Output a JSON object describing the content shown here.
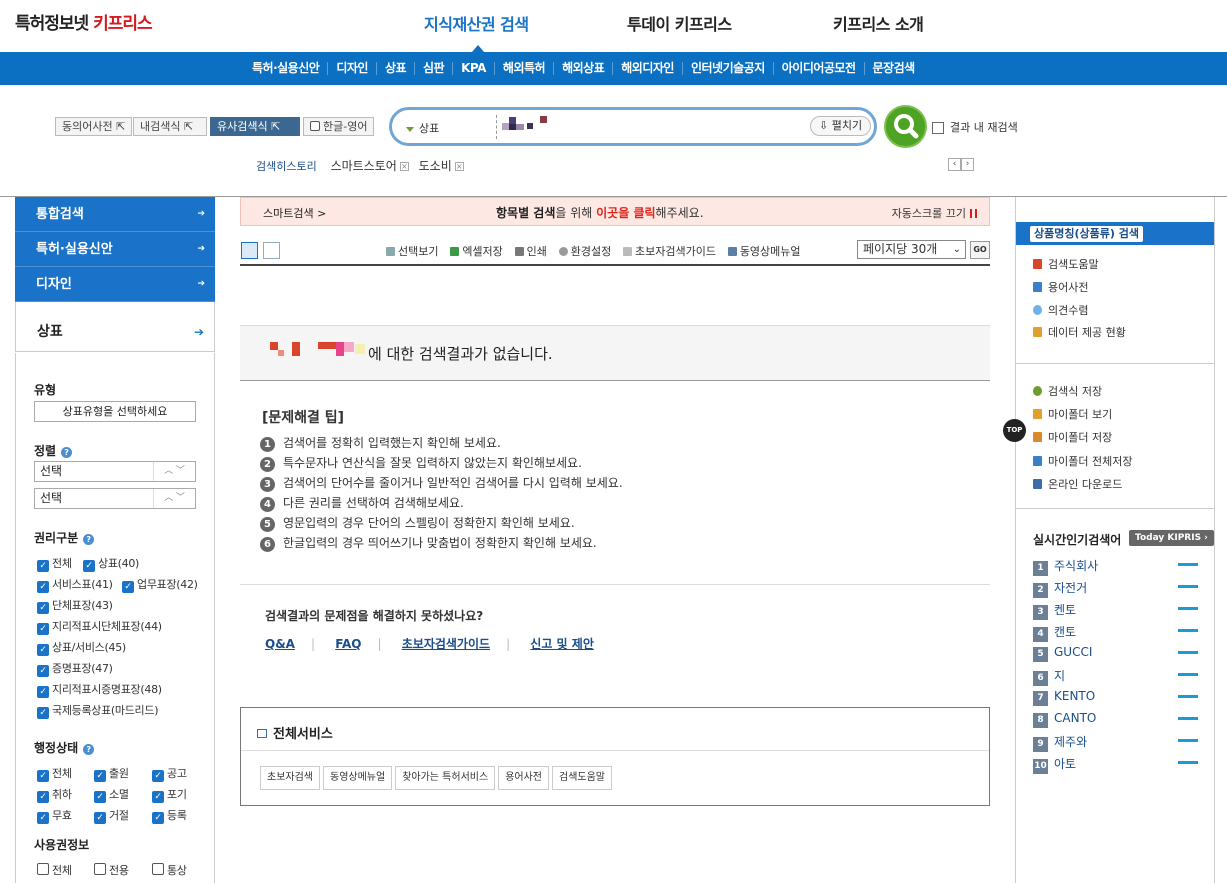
{
  "header": {
    "logo_main": "특허정보넷",
    "logo_brand": "키프리스",
    "nav": [
      "지식재산권 검색",
      "투데이 키프리스",
      "키프리스 소개"
    ]
  },
  "subnav": [
    "특허·실용신안",
    "디자인",
    "상표",
    "심판",
    "KPA",
    "해외특허",
    "해외상표",
    "해외디자인",
    "인터넷기술공지",
    "아이디어공모전",
    "문장검색"
  ],
  "search": {
    "options": [
      "동의어사전",
      "내검색식",
      "유사검색식",
      "한글-영어"
    ],
    "category": "상표",
    "expand": "펼치기",
    "research": "결과 내 재검색",
    "history_label": "검색히스토리",
    "history": [
      "스마트스토어",
      "도소비"
    ]
  },
  "leftnav": [
    "통합검색",
    "특허·실용신안",
    "디자인",
    "상표"
  ],
  "filters": {
    "type_label": "유형",
    "type_select": "상표유형을 선택하세요",
    "sort_label": "정렬",
    "sort_selects": [
      "선택",
      "선택"
    ],
    "right_label": "권리구분",
    "right_items": [
      "전체",
      "상표(40)",
      "서비스표(41)",
      "업무표장(42)",
      "단체표장(43)",
      "지리적표시단체표장(44)",
      "상표/서비스(45)",
      "증명표장(47)",
      "지리적표시증명표장(48)",
      "국제등록상표(마드리드)"
    ],
    "status_label": "행정상태",
    "status_items": [
      "전체",
      "출원",
      "공고",
      "취하",
      "소멸",
      "포기",
      "무효",
      "거절",
      "등록"
    ],
    "usage_label": "사용권정보",
    "usage_items": [
      "전체",
      "전용",
      "통상"
    ]
  },
  "smartbar": {
    "left": "스마트검색 >",
    "center_pre": "항목별 검색",
    "center_mid": "을 위해 ",
    "center_link": "이곳을 클릭",
    "center_post": "해주세요.",
    "right": "자동스크롤 끄기"
  },
  "toolbar": {
    "items": [
      "선택보기",
      "엑셀저장",
      "인쇄",
      "환경설정",
      "초보자검색가이드",
      "동영상메뉴얼"
    ],
    "perpage": "페이지당 30개",
    "go": "GO"
  },
  "noresult": "에 대한 검색결과가 없습니다.",
  "tips": {
    "title": "[문제해결 팁]",
    "items": [
      "검색어를 정확히 입력했는지 확인해 보세요.",
      "특수문자나 연산식을 잘못 입력하지 않았는지 확인해보세요.",
      "검색어의 단어수를 줄이거나 일반적인 검색어를 다시 입력해 보세요.",
      "다른 권리를 선택하여 검색해보세요.",
      "영문입력의 경우 단어의 스펠링이 정확한지 확인해 보세요.",
      "한글입력의 경우 띄어쓰기나 맞춤법이 정확한지 확인해 보세요."
    ]
  },
  "faq": {
    "question": "검색결과의 문제점을 해결하지 못하셨나요?",
    "links": [
      "Q&A",
      "FAQ",
      "초보자검색가이드",
      "신고 및 제안"
    ]
  },
  "allservice": {
    "title": "전체서비스",
    "buttons": [
      "초보자검색",
      "동영상메뉴얼",
      "찾아가는 특허서비스",
      "용어사전",
      "검색도움말"
    ]
  },
  "right": {
    "top": "상품명칭(상품류) 검색",
    "links1": [
      "검색도움말",
      "용어사전",
      "의견수렴",
      "데이터 제공 현황"
    ],
    "links2": [
      "검색식 저장",
      "마이폴더 보기",
      "마이폴더 저장",
      "마이폴더 전체저장",
      "온라인 다운로드"
    ],
    "popular_title": "실시간인기검색어",
    "today": "Today KIPRIS",
    "keywords": [
      "주식회사",
      "자전거",
      "켄토",
      "캔토",
      "GUCCI",
      "지",
      "KENTO",
      "CANTO",
      "제주와",
      "아토"
    ],
    "top_btn": "TOP"
  }
}
